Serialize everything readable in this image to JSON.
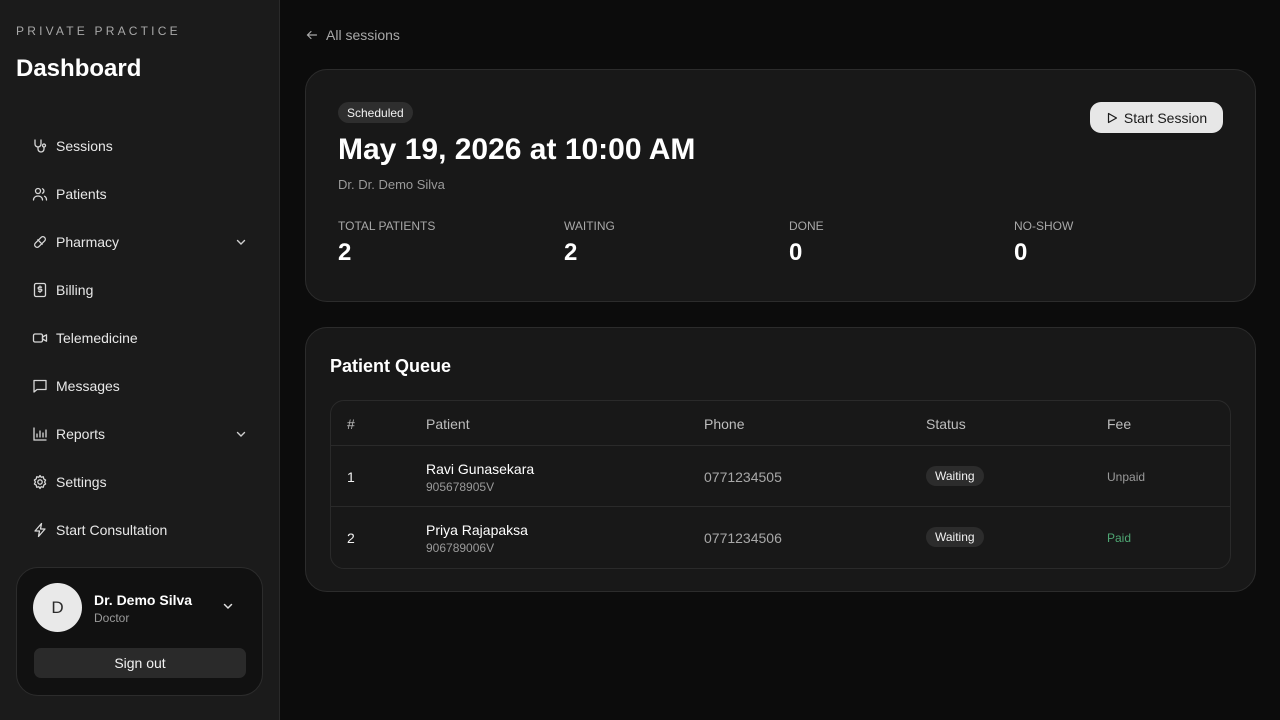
{
  "sidebar": {
    "brand_sub": "PRIVATE PRACTICE",
    "brand_title": "Dashboard",
    "items": [
      {
        "label": "Sessions",
        "icon": "stethoscope-icon"
      },
      {
        "label": "Patients",
        "icon": "users-icon"
      },
      {
        "label": "Pharmacy",
        "icon": "pill-icon",
        "expandable": true
      },
      {
        "label": "Billing",
        "icon": "receipt-icon"
      },
      {
        "label": "Telemedicine",
        "icon": "video-icon"
      },
      {
        "label": "Messages",
        "icon": "message-icon"
      },
      {
        "label": "Reports",
        "icon": "bar-chart-icon",
        "expandable": true
      },
      {
        "label": "Settings",
        "icon": "gear-icon"
      },
      {
        "label": "Start Consultation",
        "icon": "lightning-icon"
      }
    ],
    "user": {
      "initial": "D",
      "name": "Dr. Demo Silva",
      "role": "Doctor",
      "sign_out": "Sign out"
    }
  },
  "main": {
    "back_link": "All sessions",
    "session": {
      "status_badge": "Scheduled",
      "title": "May 19, 2026 at 10:00 AM",
      "doctor": "Dr. Dr. Demo Silva",
      "start_button": "Start Session",
      "stats": [
        {
          "label": "TOTAL PATIENTS",
          "value": "2"
        },
        {
          "label": "WAITING",
          "value": "2"
        },
        {
          "label": "DONE",
          "value": "0"
        },
        {
          "label": "NO-SHOW",
          "value": "0"
        }
      ]
    },
    "queue": {
      "title": "Patient Queue",
      "columns": [
        "#",
        "Patient",
        "Phone",
        "Status",
        "Fee"
      ],
      "rows": [
        {
          "num": "1",
          "name": "Ravi Gunasekara",
          "nic": "905678905V",
          "phone": "0771234505",
          "status": "Waiting",
          "fee": "Unpaid",
          "fee_color": "#9a9a9a"
        },
        {
          "num": "2",
          "name": "Priya Rajapaksa",
          "nic": "906789006V",
          "phone": "0771234506",
          "status": "Waiting",
          "fee": "Paid",
          "fee_color": "#4ea673"
        }
      ]
    }
  }
}
